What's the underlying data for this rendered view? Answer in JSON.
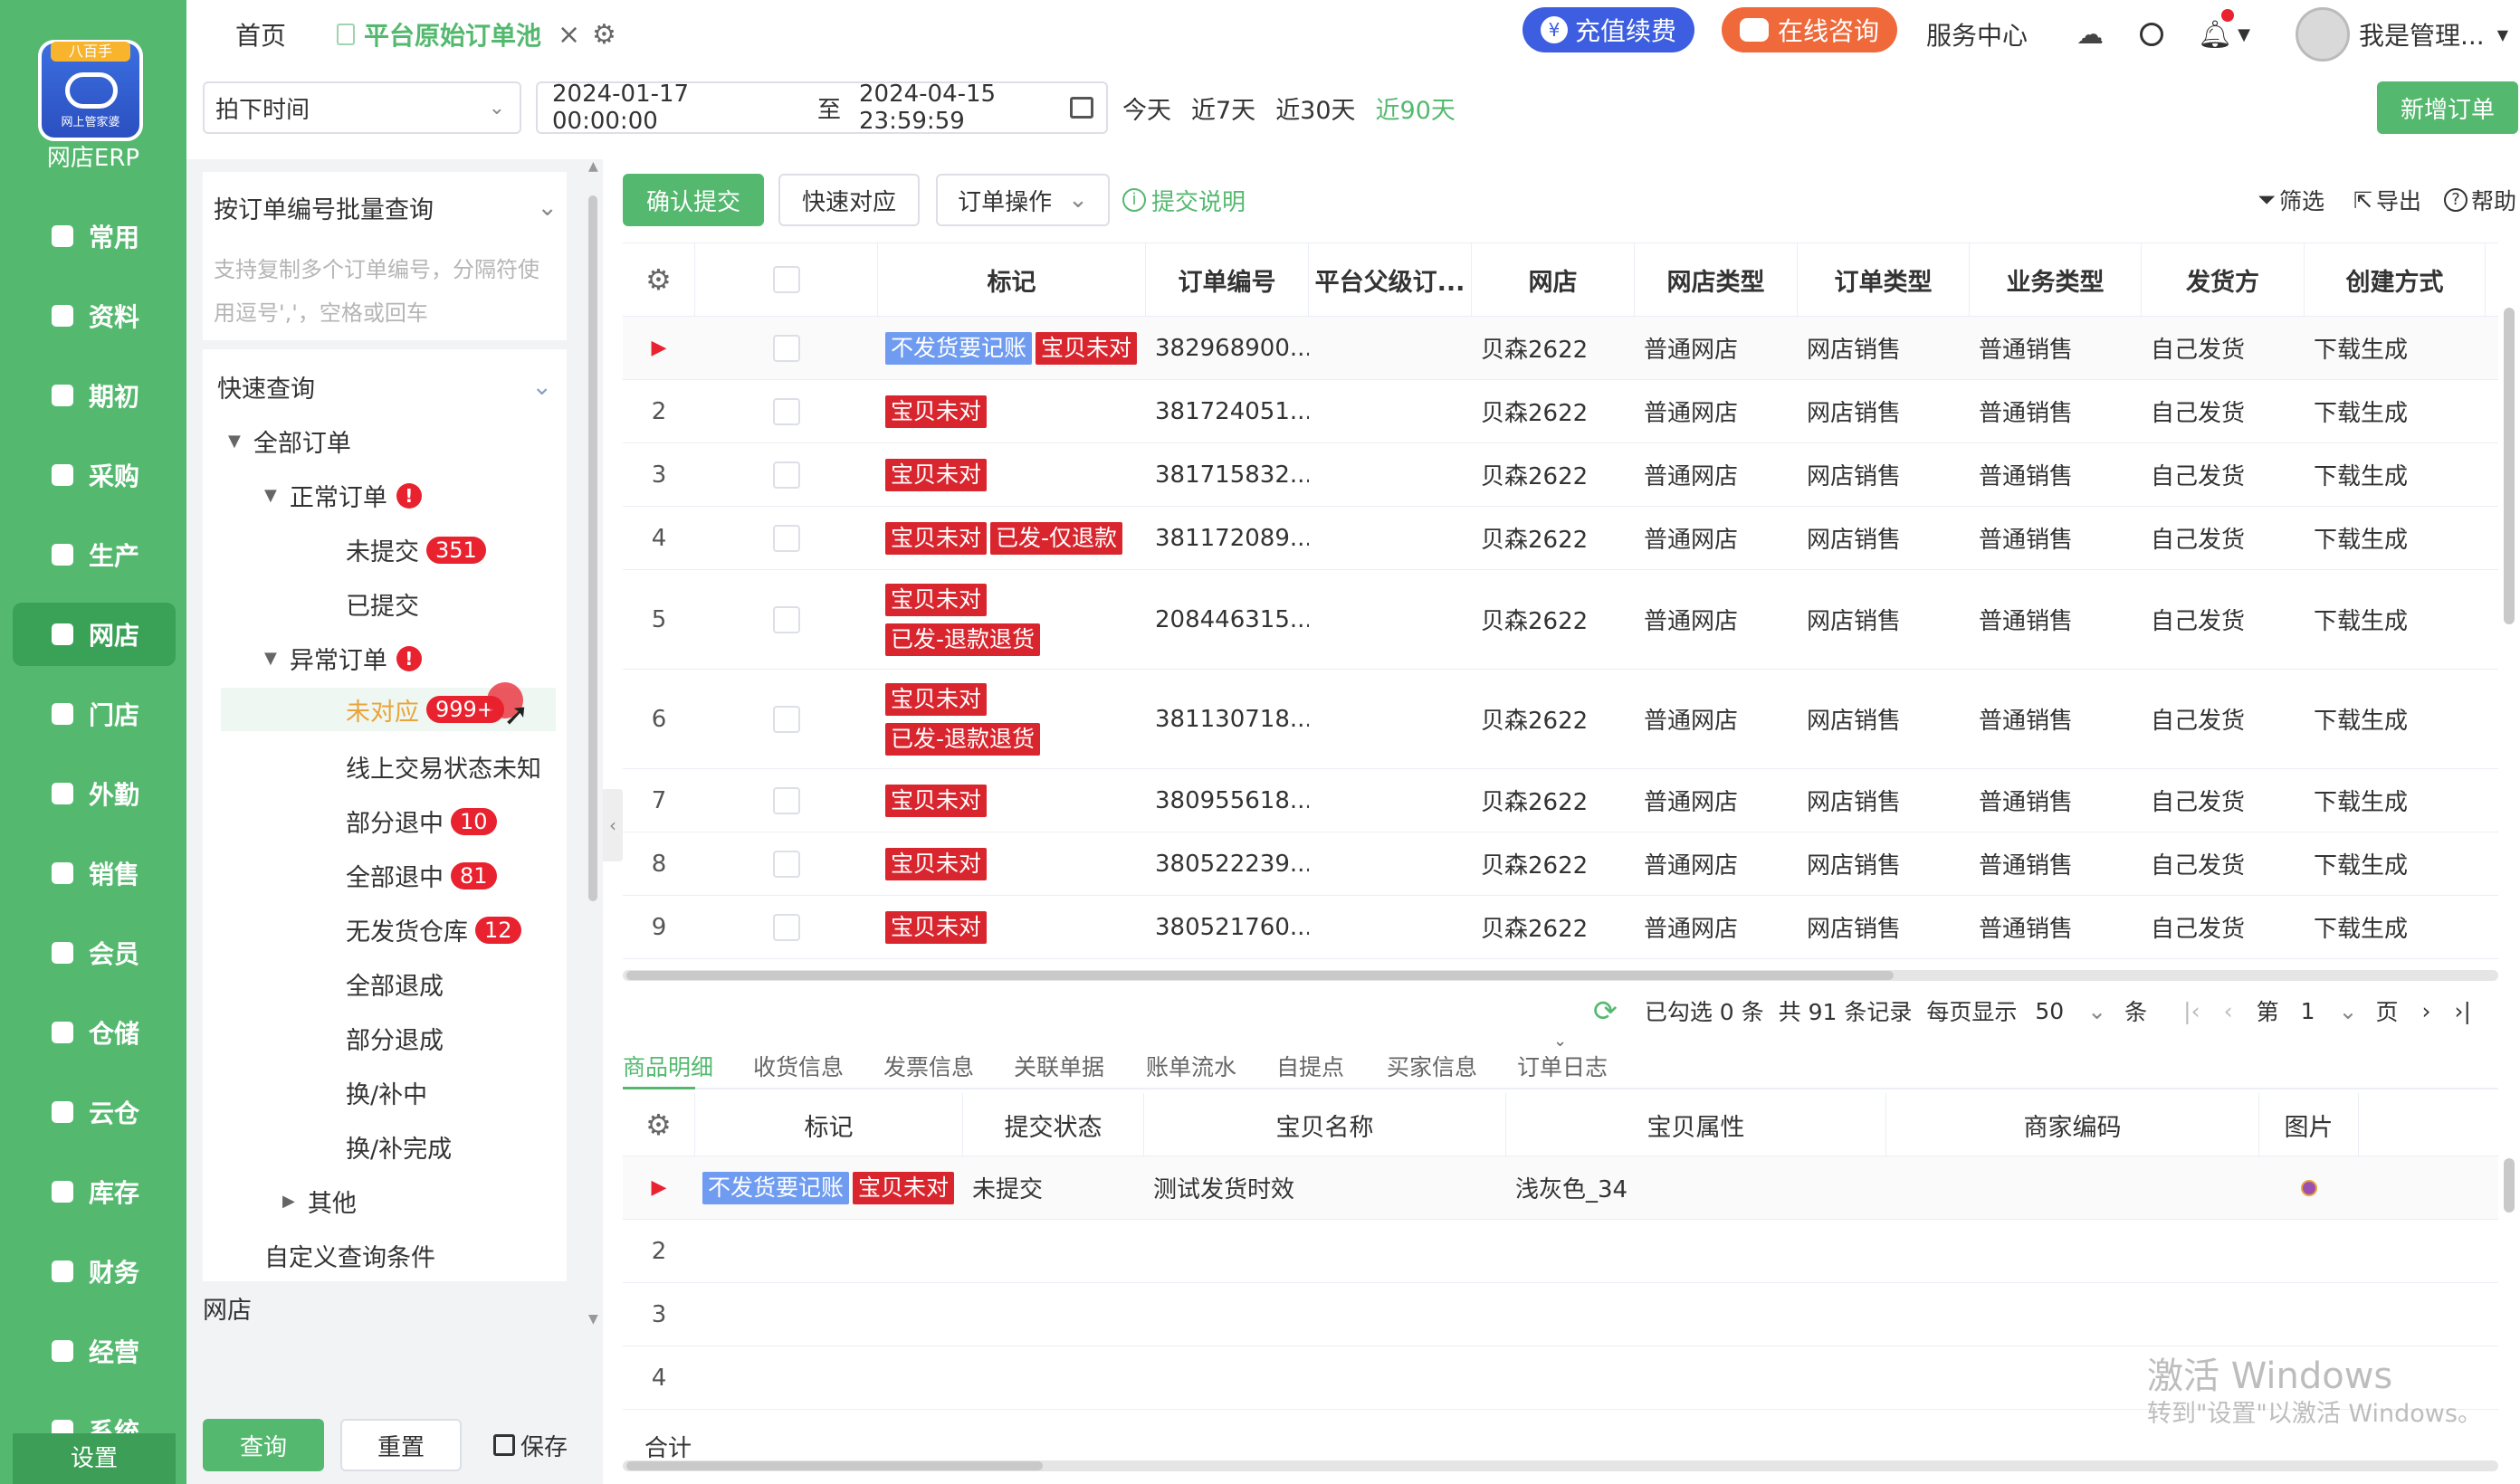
{
  "nav": {
    "logo_top": "八百手",
    "logo_sub": "网上管家婆",
    "brand": "网店ERP",
    "items": [
      {
        "label": "常用",
        "icon": "star-icon"
      },
      {
        "label": "资料",
        "icon": "document-icon"
      },
      {
        "label": "期初",
        "icon": "target-icon"
      },
      {
        "label": "采购",
        "icon": "cart-icon"
      },
      {
        "label": "生产",
        "icon": "factory-icon"
      },
      {
        "label": "网店",
        "icon": "shop-icon"
      },
      {
        "label": "门店",
        "icon": "store-icon"
      },
      {
        "label": "外勤",
        "icon": "compass-icon"
      },
      {
        "label": "销售",
        "icon": "chart-icon"
      },
      {
        "label": "会员",
        "icon": "member-icon"
      },
      {
        "label": "仓储",
        "icon": "warehouse-icon"
      },
      {
        "label": "云仓",
        "icon": "cloud-warehouse-icon"
      },
      {
        "label": "库存",
        "icon": "stock-icon"
      },
      {
        "label": "财务",
        "icon": "finance-icon"
      },
      {
        "label": "经营",
        "icon": "business-icon"
      },
      {
        "label": "系统",
        "icon": "system-icon"
      }
    ],
    "active_index": 5,
    "settings": "设置"
  },
  "topbar": {
    "home_tab": "首页",
    "active_tab": "平台原始订单池",
    "recharge": "充值续费",
    "consult": "在线咨询",
    "service": "服务中心",
    "user": "我是管理..."
  },
  "filter": {
    "time_type": "拍下时间",
    "start": "2024-01-17 00:00:00",
    "to": "至",
    "end": "2024-04-15 23:59:59",
    "quick": [
      "今天",
      "近7天",
      "近30天",
      "近90天"
    ],
    "new_order": "新增订单"
  },
  "left": {
    "batch_query": "按订单编号批量查询",
    "batch_placeholder": "支持复制多个订单编号，分隔符使用逗号','，空格或回车",
    "quick_query": "快速查询",
    "all_orders": "全部订单",
    "normal": "正常订单",
    "warn_mark": "!",
    "unsubmitted": "未提交",
    "unsubmitted_count": "351",
    "submitted": "已提交",
    "abnormal": "异常订单",
    "items": [
      {
        "label": "未对应",
        "count": "999+"
      },
      {
        "label": "线上交易状态未知",
        "count": ""
      },
      {
        "label": "部分退中",
        "count": "10"
      },
      {
        "label": "全部退中",
        "count": "81"
      },
      {
        "label": "无发货仓库",
        "count": "12"
      },
      {
        "label": "全部退成",
        "count": ""
      },
      {
        "label": "部分退成",
        "count": ""
      },
      {
        "label": "换/补中",
        "count": ""
      },
      {
        "label": "换/补完成",
        "count": ""
      }
    ],
    "other": "其他",
    "custom": "自定义查询条件",
    "shop_label": "网店",
    "query_btn": "查询",
    "reset_btn": "重置",
    "save_btn": "保存"
  },
  "toolbar": {
    "confirm": "确认提交",
    "quick_match": "快速对应",
    "order_ops": "订单操作",
    "submit_help": "提交说明",
    "filter": "筛选",
    "export": "导出",
    "help": "帮助"
  },
  "grid": {
    "headers": [
      "标记",
      "订单编号",
      "平台父级订...",
      "网店",
      "网店类型",
      "订单类型",
      "业务类型",
      "发货方",
      "创建方式"
    ],
    "rows": [
      {
        "no": "",
        "tags": [
          {
            "t": "不发货要记账",
            "c": "blue"
          },
          {
            "t": "宝贝未对",
            "c": "red"
          }
        ],
        "order": "382968900...",
        "shop": "贝森2622",
        "shop_type": "普通网店",
        "order_type": "网店销售",
        "biz_type": "普通销售",
        "shipper": "自己发货",
        "create": "下载生成"
      },
      {
        "no": "2",
        "tags": [
          {
            "t": "宝贝未对",
            "c": "red"
          }
        ],
        "order": "381724051...",
        "shop": "贝森2622",
        "shop_type": "普通网店",
        "order_type": "网店销售",
        "biz_type": "普通销售",
        "shipper": "自己发货",
        "create": "下载生成"
      },
      {
        "no": "3",
        "tags": [
          {
            "t": "宝贝未对",
            "c": "red"
          }
        ],
        "order": "381715832...",
        "shop": "贝森2622",
        "shop_type": "普通网店",
        "order_type": "网店销售",
        "biz_type": "普通销售",
        "shipper": "自己发货",
        "create": "下载生成"
      },
      {
        "no": "4",
        "tags": [
          {
            "t": "宝贝未对",
            "c": "red"
          },
          {
            "t": "已发-仅退款",
            "c": "red"
          }
        ],
        "order": "381172089...",
        "shop": "贝森2622",
        "shop_type": "普通网店",
        "order_type": "网店销售",
        "biz_type": "普通销售",
        "shipper": "自己发货",
        "create": "下载生成"
      },
      {
        "no": "5",
        "tags": [
          {
            "t": "宝贝未对",
            "c": "red"
          },
          {
            "t": "已发-退款退货",
            "c": "red"
          }
        ],
        "order": "208446315...",
        "shop": "贝森2622",
        "shop_type": "普通网店",
        "order_type": "网店销售",
        "biz_type": "普通销售",
        "shipper": "自己发货",
        "create": "下载生成"
      },
      {
        "no": "6",
        "tags": [
          {
            "t": "宝贝未对",
            "c": "red"
          },
          {
            "t": "已发-退款退货",
            "c": "red"
          }
        ],
        "order": "381130718...",
        "shop": "贝森2622",
        "shop_type": "普通网店",
        "order_type": "网店销售",
        "biz_type": "普通销售",
        "shipper": "自己发货",
        "create": "下载生成"
      },
      {
        "no": "7",
        "tags": [
          {
            "t": "宝贝未对",
            "c": "red"
          }
        ],
        "order": "380955618...",
        "shop": "贝森2622",
        "shop_type": "普通网店",
        "order_type": "网店销售",
        "biz_type": "普通销售",
        "shipper": "自己发货",
        "create": "下载生成"
      },
      {
        "no": "8",
        "tags": [
          {
            "t": "宝贝未对",
            "c": "red"
          }
        ],
        "order": "380522239...",
        "shop": "贝森2622",
        "shop_type": "普通网店",
        "order_type": "网店销售",
        "biz_type": "普通销售",
        "shipper": "自己发货",
        "create": "下载生成"
      },
      {
        "no": "9",
        "tags": [
          {
            "t": "宝贝未对",
            "c": "red"
          }
        ],
        "order": "380521760...",
        "shop": "贝森2622",
        "shop_type": "普通网店",
        "order_type": "网店销售",
        "biz_type": "普通销售",
        "shipper": "自己发货",
        "create": "下载生成"
      }
    ]
  },
  "pager": {
    "selected": "已勾选 0 条",
    "total": "共 91 条记录",
    "per_page_label": "每页显示",
    "per_page": "50",
    "unit": "条",
    "page_prefix": "第",
    "page": "1",
    "page_suffix": "页"
  },
  "detail": {
    "tabs": [
      "商品明细",
      "收货信息",
      "发票信息",
      "关联单据",
      "账单流水",
      "自提点",
      "买家信息",
      "订单日志"
    ],
    "headers": [
      "标记",
      "提交状态",
      "宝贝名称",
      "宝贝属性",
      "商家编码",
      "图片"
    ],
    "row": {
      "tags": [
        {
          "t": "不发货要记账",
          "c": "blue"
        },
        {
          "t": "宝贝未对",
          "c": "red"
        }
      ],
      "status": "未提交",
      "name": "测试发货时效",
      "attr": "浅灰色_34"
    },
    "row_nums": [
      "2",
      "3",
      "4"
    ],
    "total": "合计"
  },
  "watermark": {
    "line1": "激活 Windows",
    "line2": "转到\"设置\"以激活 Windows。"
  },
  "colors": {
    "primary": "#54b96f",
    "danger": "#d9262e",
    "tag_blue": "#6f9cf0"
  }
}
